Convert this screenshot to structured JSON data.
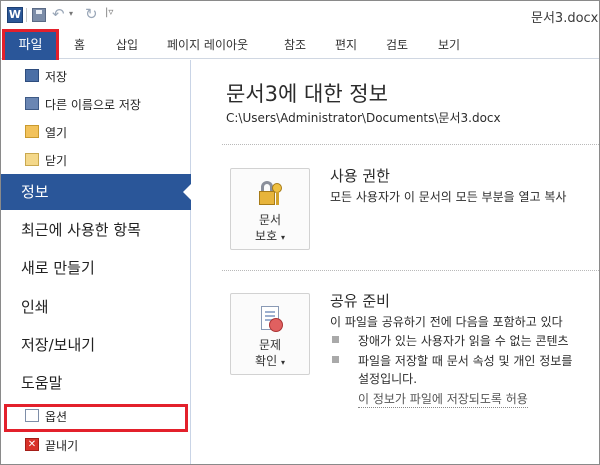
{
  "titlebar": {
    "app_icon_letter": "W",
    "document_title": "문서3.docx"
  },
  "ribbon": {
    "file_tab": "파일",
    "tabs": [
      "홈",
      "삽입",
      "페이지 레이아웃",
      "참조",
      "편지",
      "검토",
      "보기"
    ]
  },
  "backstage": {
    "quick_commands": [
      {
        "label": "저장",
        "icon": "save-icon"
      },
      {
        "label": "다른 이름으로 저장",
        "icon": "save-as-icon"
      },
      {
        "label": "열기",
        "icon": "open-folder-icon"
      },
      {
        "label": "닫기",
        "icon": "close-folder-icon"
      }
    ],
    "nav": [
      {
        "label": "정보",
        "active": true
      },
      {
        "label": "최근에 사용한 항목"
      },
      {
        "label": "새로 만들기"
      },
      {
        "label": "인쇄"
      },
      {
        "label": "저장/보내기"
      },
      {
        "label": "도움말"
      }
    ],
    "options_label": "옵션",
    "exit_label": "끝내기"
  },
  "info": {
    "title": "문서3에 대한 정보",
    "path": "C:\\Users\\Administrator\\Documents\\문서3.docx",
    "permissions": {
      "button_line1": "문서",
      "button_line2": "보호",
      "button_dropdown": "▾",
      "heading": "사용 권한",
      "description": "모든 사용자가 이 문서의 모든 부분을 열고 복사"
    },
    "prepare": {
      "button_line1": "문제",
      "button_line2": "확인",
      "button_dropdown": "▾",
      "heading": "공유 준비",
      "description": "이 파일을 공유하기 전에 다음을 포함하고 있다",
      "bullets": [
        "장애가 있는 사용자가 읽을 수 없는 콘텐츠",
        "파일을 저장할 때 문서 속성 및 개인 정보를"
      ],
      "bullet_continuation": "설정입니다.",
      "link": "이 정보가 파일에 저장되도록 허용"
    }
  },
  "colors": {
    "accent_blue": "#2a5699",
    "highlight_red": "#e3202b"
  }
}
